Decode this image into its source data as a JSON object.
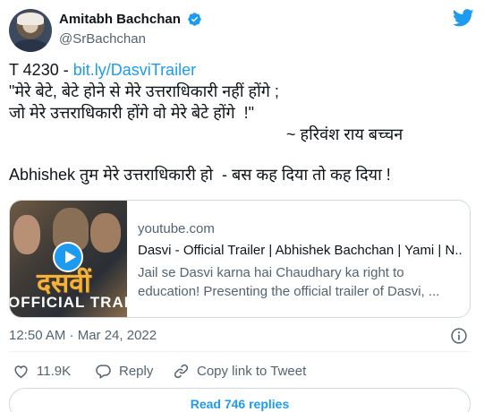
{
  "author": {
    "display_name": "Amitabh Bachchan",
    "handle": "@SrBachchan",
    "verified_icon": "verified-badge-icon",
    "avatar_icon": "profile-avatar"
  },
  "brand": {
    "logo_icon": "twitter-bird-icon",
    "accent_color": "#1d9bf0"
  },
  "tweet": {
    "id_prefix": "T 4230 - ",
    "link_text": "bit.ly/DasviTrailer",
    "quote_line1": "\"मेरे बेटे, बेटे होने से मेरे उत्तराधिकारी नहीं होंगे ;",
    "quote_line2": "जो मेरे उत्तराधिकारी होंगे वो मेरे बेटे होंगे  !\"",
    "quote_attribution": "~ हरिवंश राय बच्चन",
    "closing_line": "Abhishek तुम मेरे उत्तराधिकारी हो  - बस कह दिया तो कह दिया !"
  },
  "link_card": {
    "domain": "youtube.com",
    "title": "Dasvi - Official Trailer | Abhishek Bachchan | Yami | N...",
    "description": "Jail se Dasvi karna hai Chaudhary ka right to education! Presenting the official trailer of Dasvi, ...",
    "thumbnail_title": "दसवीं",
    "thumbnail_caption": "OFFICIAL TRAILER",
    "play_icon": "play-icon"
  },
  "meta": {
    "timestamp": "12:50 AM · Mar 24, 2022",
    "info_icon": "info-icon"
  },
  "actions": {
    "like_count": "11.9K",
    "reply_label": "Reply",
    "copy_link_label": "Copy link to Tweet"
  },
  "replies_button": "Read 746 replies"
}
